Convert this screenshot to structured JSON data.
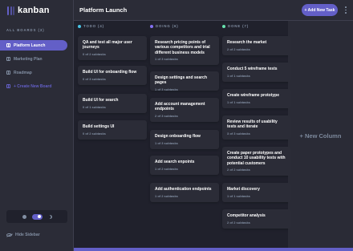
{
  "app": {
    "logo_text": "kanban"
  },
  "sidebar": {
    "heading": "ALL BOARDS (3)",
    "boards": [
      {
        "label": "Platform Launch",
        "active": true
      },
      {
        "label": "Marketing Plan",
        "active": false
      },
      {
        "label": "Roadmap",
        "active": false
      }
    ],
    "create_label": "+ Create New Board",
    "hide_label": "Hide Sidebar"
  },
  "header": {
    "title": "Platform Launch",
    "add_task_label": "+ Add New Task"
  },
  "colors": {
    "accent": "#635fc7",
    "todo": "#49c4e5",
    "doing": "#8471f2",
    "done": "#67e2ae"
  },
  "columns": [
    {
      "name": "TODO (4)",
      "cards": [
        {
          "title": "QA and test all major user journeys",
          "subtasks": "0 of 2 subtasks"
        },
        {
          "title": "Build UI for onboarding flow",
          "subtasks": "0 of 3 subtasks"
        },
        {
          "title": "Build UI for search",
          "subtasks": "0 of 1 subtasks"
        },
        {
          "title": "Build settings UI",
          "subtasks": "0 of 2 subtasks"
        }
      ]
    },
    {
      "name": "DOING (6)",
      "cards": [
        {
          "title": "Research pricing points of various competitors and trial different business models",
          "subtasks": "1 of 3 subtasks"
        },
        {
          "title": "Design settings and search pages",
          "subtasks": "1 of 3 subtasks"
        },
        {
          "title": "Add account management endpoints",
          "subtasks": "2 of 3 subtasks"
        },
        {
          "title": "Design onboarding flow",
          "subtasks": "1 of 3 subtasks"
        },
        {
          "title": "Add search enpoints",
          "subtasks": "1 of 2 subtasks"
        },
        {
          "title": "Add authentication endpoints",
          "subtasks": "1 of 2 subtasks"
        }
      ]
    },
    {
      "name": "DONE (7)",
      "cards": [
        {
          "title": "Research the market",
          "subtasks": "2 of 2 subtasks"
        },
        {
          "title": "Conduct 5 wireframe tests",
          "subtasks": "1 of 1 subtasks"
        },
        {
          "title": "Create wireframe prototype",
          "subtasks": "1 of 1 subtasks"
        },
        {
          "title": "Review results of usability tests and iterate",
          "subtasks": "3 of 3 subtasks"
        },
        {
          "title": "Create paper prototypes and conduct 10 usability tests with potential customers",
          "subtasks": "2 of 2 subtasks"
        },
        {
          "title": "Market discovery",
          "subtasks": "1 of 1 subtasks"
        },
        {
          "title": "Competitor analysis",
          "subtasks": "2 of 2 subtasks"
        }
      ]
    }
  ],
  "new_column_label": "+ New Column"
}
